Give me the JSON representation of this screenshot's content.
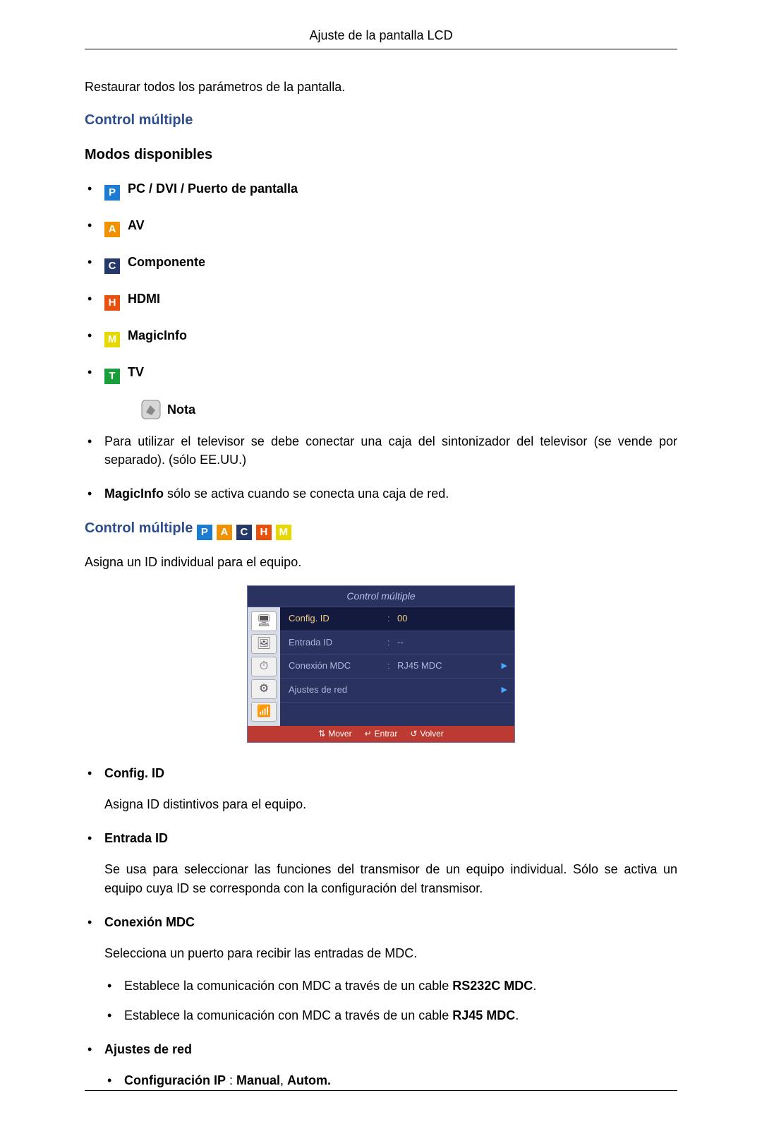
{
  "header": {
    "title": "Ajuste de la pantalla LCD"
  },
  "intro": {
    "restore": "Restaurar todos los parámetros de la pantalla."
  },
  "section1": {
    "title": "Control múltiple",
    "modes_title": "Modos disponibles",
    "modes": [
      {
        "badge": "P",
        "cls": "mb-p",
        "label": "PC / DVI / Puerto de pantalla"
      },
      {
        "badge": "A",
        "cls": "mb-a",
        "label": "AV"
      },
      {
        "badge": "C",
        "cls": "mb-c",
        "label": "Componente"
      },
      {
        "badge": "H",
        "cls": "mb-h",
        "label": "HDMI"
      },
      {
        "badge": "M",
        "cls": "mb-m",
        "label": "MagicInfo"
      },
      {
        "badge": "T",
        "cls": "mb-t",
        "label": "TV"
      }
    ],
    "note_label": "Nota",
    "notes": [
      {
        "plain": "Para utilizar el televisor se debe conectar una caja del sintonizador del televisor (se vende por separado). (sólo EE.UU.)"
      },
      {
        "bold": "MagicInfo",
        "rest": " sólo se activa cuando se conecta una caja de red."
      }
    ]
  },
  "section2": {
    "title": "Control múltiple",
    "badges": [
      "P",
      "A",
      "C",
      "H",
      "M"
    ],
    "intro": "Asigna un ID individual para el equipo.",
    "osd": {
      "title": "Control múltiple",
      "rows": [
        {
          "label": "Config. ID",
          "val": "00",
          "sel": true
        },
        {
          "label": "Entrada ID",
          "val": "--"
        },
        {
          "label": "Conexión MDC",
          "val": "RJ45 MDC",
          "arrow": true
        },
        {
          "label": "Ajustes de red",
          "val": "",
          "arrow": true
        }
      ],
      "footer": {
        "move": "Mover",
        "enter": "Entrar",
        "back": "Volver"
      }
    },
    "items": {
      "config_id": {
        "title": "Config. ID",
        "desc": "Asigna ID distintivos para el equipo."
      },
      "entrada_id": {
        "title": "Entrada ID",
        "desc": "Se usa para seleccionar las funciones del transmisor de un equipo individual. Sólo se activa un equipo cuya ID se corresponda con la configuración del transmisor."
      },
      "mdc": {
        "title": "Conexión MDC",
        "desc": "Selecciona un puerto para recibir las entradas de MDC.",
        "sub": [
          {
            "pre": "Establece la comunicación con MDC a través de un cable ",
            "bold": "RS232C MDC",
            "post": "."
          },
          {
            "pre": "Establece la comunicación con MDC a través de un cable ",
            "bold": "RJ45 MDC",
            "post": "."
          }
        ]
      },
      "ajustes": {
        "title": "Ajustes de red",
        "sub": {
          "label": "Configuración IP",
          "sep": " : ",
          "opt1": "Manual",
          "comma": ", ",
          "opt2": "Autom."
        }
      }
    }
  }
}
